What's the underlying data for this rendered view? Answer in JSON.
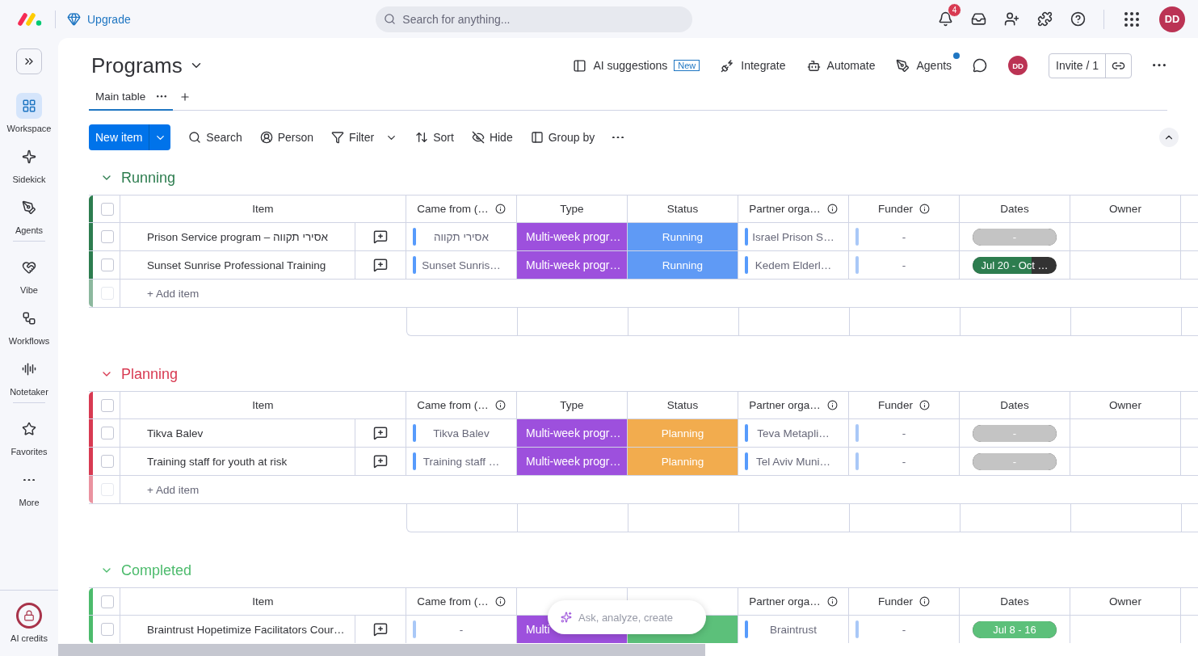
{
  "topbar": {
    "upgrade": "Upgrade",
    "search": {
      "placeholder": "Search for anything..."
    },
    "notifications_badge": "4",
    "avatar": "DD"
  },
  "sidebar": {
    "sections": [
      {
        "items": [
          {
            "label": "Workspace",
            "kind": "workspace",
            "selected": true
          },
          {
            "label": "Sidekick",
            "kind": "sidekick",
            "selected": false
          },
          {
            "label": "Agents",
            "kind": "agents",
            "selected": false
          }
        ]
      },
      {
        "items": [
          {
            "label": "Vibe",
            "kind": "vibe",
            "selected": false
          },
          {
            "label": "Workflows",
            "kind": "workflows",
            "selected": false
          },
          {
            "label": "Notetaker",
            "kind": "notetaker",
            "selected": false
          }
        ]
      },
      {
        "items": [
          {
            "label": "Favorites",
            "kind": "favorites",
            "selected": false
          },
          {
            "label": "More",
            "kind": "more",
            "selected": false
          }
        ]
      }
    ],
    "ai_credits": "AI credits"
  },
  "board": {
    "title": "Programs",
    "avatar": "DD",
    "invite": "Invite / 1",
    "actions": [
      {
        "label": "AI suggestions",
        "kind": "ai",
        "badge": "New"
      },
      {
        "label": "Integrate",
        "kind": "integrate"
      },
      {
        "label": "Automate",
        "kind": "automate"
      },
      {
        "label": "Agents",
        "kind": "agents",
        "dot": true
      }
    ]
  },
  "views": [
    {
      "label": "Main table",
      "selected": true
    }
  ],
  "toolbar": {
    "new_item": "New item",
    "tools": [
      {
        "label": "Search",
        "kind": "search"
      },
      {
        "label": "Person",
        "kind": "person"
      },
      {
        "label": "Filter",
        "kind": "filter"
      },
      {
        "label": "Sort",
        "kind": "sort"
      },
      {
        "label": "Hide",
        "kind": "hide"
      },
      {
        "label": "Group by",
        "kind": "group"
      }
    ]
  },
  "groups": [
    {
      "title": "Running",
      "color": "#2d7d4f",
      "expanded": true,
      "all_checked": false,
      "add_item": "+ Add item",
      "columns": [
        {
          "label": "Item",
          "info": false
        },
        {
          "label": "Came from (…",
          "info": true
        },
        {
          "label": "Type",
          "info": false
        },
        {
          "label": "Status",
          "info": false
        },
        {
          "label": "Partner orga…",
          "info": true
        },
        {
          "label": "Funder",
          "info": true
        },
        {
          "label": "Dates",
          "info": false
        },
        {
          "label": "Owner",
          "info": false
        }
      ],
      "rows": [
        {
          "checked": false,
          "item": "Prison Service program – אסירי תקווה",
          "came_from": {
            "text": "אסירי תקווה",
            "color": "#579bfc"
          },
          "type": "Multi-week progr…",
          "status": {
            "text": "Running",
            "color": "#5f9af5"
          },
          "partner": {
            "text": "Israel Prison S…",
            "color": "#579bfc"
          },
          "funder": {
            "text": "-",
            "color": "#a9c8f7"
          },
          "dates": {
            "text": "-",
            "color": "#c4c4c4",
            "level": 1
          }
        },
        {
          "checked": false,
          "item": "Sunset Sunrise Professional Training",
          "came_from": {
            "text": "Sunset Sunris…",
            "color": "#579bfc"
          },
          "type": "Multi-week progr…",
          "status": {
            "text": "Running",
            "color": "#5f9af5"
          },
          "partner": {
            "text": "Kedem Elderl…",
            "color": "#579bfc"
          },
          "funder": {
            "text": "-",
            "color": "#a9c8f7"
          },
          "dates": {
            "text": "Jul 20 - Oct …",
            "color": "#2d7d4f",
            "level": 0.7
          }
        }
      ]
    },
    {
      "title": "Planning",
      "color": "#d83a52",
      "expanded": true,
      "all_checked": false,
      "add_item": "+ Add item",
      "columns": [
        {
          "label": "Item",
          "info": false
        },
        {
          "label": "Came from (…",
          "info": true
        },
        {
          "label": "Type",
          "info": false
        },
        {
          "label": "Status",
          "info": false
        },
        {
          "label": "Partner orga…",
          "info": true
        },
        {
          "label": "Funder",
          "info": true
        },
        {
          "label": "Dates",
          "info": false
        },
        {
          "label": "Owner",
          "info": false
        }
      ],
      "rows": [
        {
          "checked": false,
          "item": "Tikva Balev",
          "came_from": {
            "text": "Tikva Balev",
            "color": "#579bfc"
          },
          "type": "Multi-week progr…",
          "status": {
            "text": "Planning",
            "color": "#f2ac4e"
          },
          "partner": {
            "text": "Teva Metapli…",
            "color": "#579bfc"
          },
          "funder": {
            "text": "-",
            "color": "#a9c8f7"
          },
          "dates": {
            "text": "-",
            "color": "#c4c4c4",
            "level": 1
          }
        },
        {
          "checked": false,
          "item": "Training staff for youth at risk",
          "came_from": {
            "text": "Training staff …",
            "color": "#579bfc"
          },
          "type": "Multi-week progr…",
          "status": {
            "text": "Planning",
            "color": "#f2ac4e"
          },
          "partner": {
            "text": "Tel Aviv Muni…",
            "color": "#579bfc"
          },
          "funder": {
            "text": "-",
            "color": "#a9c8f7"
          },
          "dates": {
            "text": "-",
            "color": "#c4c4c4",
            "level": 1
          }
        }
      ]
    },
    {
      "title": "Completed",
      "color": "#4cbb6c",
      "expanded": true,
      "all_checked": false,
      "columns": [
        {
          "label": "Item",
          "info": false
        },
        {
          "label": "Came from (…",
          "info": true
        },
        {
          "info": false
        },
        {
          "info": false
        },
        {
          "label": "Partner orga…",
          "info": true
        },
        {
          "label": "Funder",
          "info": true
        },
        {
          "label": "Dates",
          "info": false
        },
        {
          "label": "Owner",
          "info": false
        }
      ],
      "rows": [
        {
          "checked": false,
          "item": "Braintrust Hopetimize Facilitators Cour…",
          "came_from": {
            "text": "-",
            "color": "#a9c8f7"
          },
          "type": "Multi",
          "status": {
            "color": "#5cc07a"
          },
          "partner": {
            "text": "Braintrust",
            "color": "#579bfc"
          },
          "funder": {
            "text": "-",
            "color": "#a9c8f7"
          },
          "dates": {
            "text": "Jul 8 - 16",
            "color": "#5cc07a",
            "level": 1
          }
        }
      ]
    }
  ],
  "assistant": {
    "placeholder": "Ask, analyze, create"
  }
}
